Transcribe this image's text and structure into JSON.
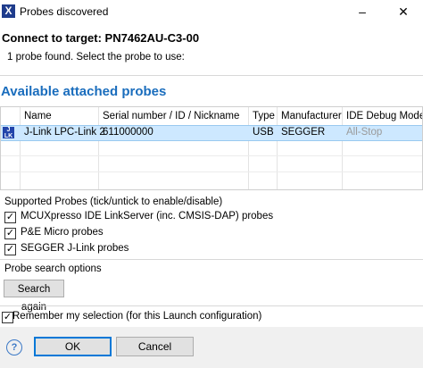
{
  "window": {
    "title": "Probes discovered",
    "app_icon": "x-app-icon",
    "minimize_glyph": "–",
    "maximize_glyph": "☐",
    "close_glyph": "✕"
  },
  "connect_title": "Connect to target: PN7462AU-C3-00",
  "probe_found_text": "1 probe found. Select the probe to use:",
  "available_title": "Available attached probes",
  "table": {
    "columns": [
      "Name",
      "Serial number / ID / Nickname",
      "Type",
      "Manufacturer",
      "IDE Debug Mode"
    ],
    "rows": [
      {
        "icon": "jlink-probe-icon",
        "icon_text": "J\nLINK",
        "name": "J-Link LPC-Link 2",
        "serial": "611000000",
        "type": "USB",
        "manufacturer": "SEGGER",
        "debug_mode": "All-Stop"
      }
    ]
  },
  "supported": {
    "label": "Supported Probes (tick/untick to enable/disable)",
    "items": [
      {
        "label": "MCUXpresso IDE LinkServer (inc. CMSIS-DAP) probes",
        "checked": true
      },
      {
        "label": "P&E Micro probes",
        "checked": true
      },
      {
        "label": "SEGGER J-Link probes",
        "checked": true
      }
    ],
    "check_glyph": "✓"
  },
  "search": {
    "label": "Probe search options",
    "button": "Search again"
  },
  "remember": {
    "label": "Remember my selection (for this Launch configuration)",
    "checked": true
  },
  "footer": {
    "help_glyph": "?",
    "ok": "OK",
    "cancel": "Cancel"
  },
  "colors": {
    "accent": "#1a6dbd",
    "selection": "#cde8ff",
    "primary_border": "#0078d7"
  }
}
